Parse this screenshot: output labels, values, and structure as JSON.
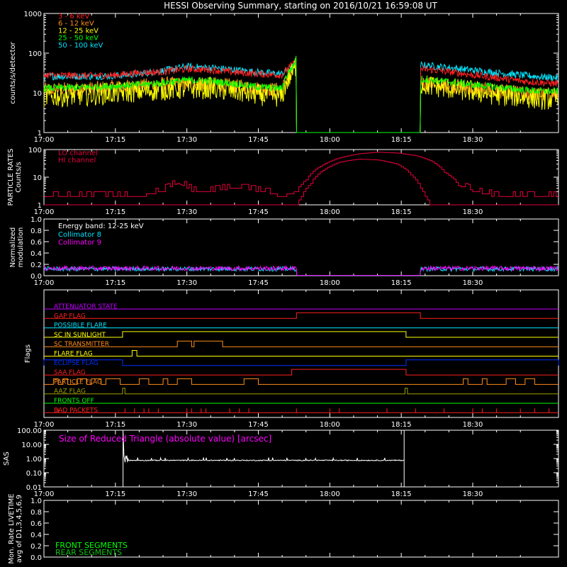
{
  "title": "HESSI Observing Summary, starting on 2016/10/21 16:59:08 UT",
  "time_ticks": [
    "17:00",
    "17:15",
    "17:30",
    "17:45",
    "18:00",
    "18:15",
    "18:30"
  ],
  "time_range_minutes": [
    0,
    108
  ],
  "colors": {
    "axes": "#ffffff",
    "red": "#ff2020",
    "orange": "#ff8c1a",
    "yellow": "#ffff00",
    "green": "#00ff00",
    "cyan": "#00e5ff",
    "magenta": "#ff00ff",
    "blue": "#0030ff",
    "purple": "#c000ff",
    "crimson": "#e0003a",
    "olive": "#a0a000",
    "darkgreen": "#10c010"
  },
  "chart_data": [
    {
      "type": "line",
      "panel": "count-rates",
      "ylabel": "counts/s/detector",
      "yscale": "log",
      "ylim": [
        1,
        1000
      ],
      "yticks": [
        "1",
        "10",
        "100",
        "1000"
      ],
      "gap_minutes": [
        53,
        79
      ],
      "series": [
        {
          "name": "3 - 6 keV",
          "color": "#ff2020",
          "knots": [
            [
              0,
              28
            ],
            [
              10,
              27
            ],
            [
              15,
              28
            ],
            [
              20,
              32
            ],
            [
              25,
              34
            ],
            [
              30,
              40
            ],
            [
              35,
              38
            ],
            [
              40,
              33
            ],
            [
              45,
              30
            ],
            [
              50,
              28
            ],
            [
              52.5,
              55
            ],
            [
              53,
              70
            ],
            [
              79.5,
              40
            ],
            [
              85,
              34
            ],
            [
              90,
              28
            ],
            [
              95,
              24
            ],
            [
              100,
              20
            ],
            [
              105,
              18
            ],
            [
              108,
              17
            ]
          ]
        },
        {
          "name": "6 - 12 keV",
          "color": "#ff8c1a",
          "knots": [
            [
              0,
              12
            ],
            [
              10,
              13
            ],
            [
              15,
              14
            ],
            [
              20,
              15
            ],
            [
              25,
              17
            ],
            [
              30,
              17
            ],
            [
              35,
              17
            ],
            [
              40,
              15
            ],
            [
              45,
              13
            ],
            [
              50,
              12
            ],
            [
              52.5,
              40
            ],
            [
              53,
              60
            ],
            [
              79.5,
              18
            ],
            [
              85,
              15
            ],
            [
              90,
              13
            ],
            [
              95,
              11
            ],
            [
              100,
              10
            ],
            [
              105,
              9
            ],
            [
              108,
              9
            ]
          ]
        },
        {
          "name": "12 - 25 keV",
          "color": "#ffff00",
          "knots": [
            [
              0,
              8
            ],
            [
              10,
              9
            ],
            [
              15,
              10
            ],
            [
              20,
              11
            ],
            [
              25,
              12
            ],
            [
              30,
              13
            ],
            [
              35,
              13
            ],
            [
              40,
              11
            ],
            [
              45,
              9
            ],
            [
              50,
              8
            ],
            [
              52.5,
              35
            ],
            [
              53,
              55
            ],
            [
              79.5,
              16
            ],
            [
              85,
              13
            ],
            [
              90,
              11
            ],
            [
              95,
              9
            ],
            [
              100,
              8
            ],
            [
              105,
              7
            ],
            [
              108,
              7
            ]
          ]
        },
        {
          "name": "25 - 50 keV",
          "color": "#00ff00",
          "knots": [
            [
              0,
              13
            ],
            [
              10,
              14
            ],
            [
              15,
              15
            ],
            [
              20,
              16
            ],
            [
              25,
              18
            ],
            [
              30,
              21
            ],
            [
              35,
              20
            ],
            [
              40,
              17
            ],
            [
              45,
              14
            ],
            [
              50,
              13
            ],
            [
              52.5,
              50
            ],
            [
              53,
              80
            ],
            [
              79.5,
              22
            ],
            [
              85,
              19
            ],
            [
              90,
              16
            ],
            [
              95,
              14
            ],
            [
              100,
              12
            ],
            [
              105,
              11
            ],
            [
              108,
              11
            ]
          ]
        },
        {
          "name": "50 - 100 keV",
          "color": "#00e5ff",
          "knots": [
            [
              0,
              26
            ],
            [
              10,
              26
            ],
            [
              15,
              27
            ],
            [
              20,
              30
            ],
            [
              25,
              36
            ],
            [
              30,
              46
            ],
            [
              35,
              43
            ],
            [
              40,
              38
            ],
            [
              45,
              33
            ],
            [
              50,
              30
            ],
            [
              52.5,
              50
            ],
            [
              53,
              65
            ],
            [
              79.5,
              50
            ],
            [
              85,
              43
            ],
            [
              90,
              37
            ],
            [
              95,
              32
            ],
            [
              100,
              28
            ],
            [
              105,
              25
            ],
            [
              108,
              24
            ]
          ]
        }
      ]
    },
    {
      "type": "line",
      "panel": "particle-rates",
      "ylabel": "PARTICLE RATES",
      "ylabel2": "Counts/s",
      "yscale": "log",
      "ylim": [
        1,
        100
      ],
      "yticks": [
        "1",
        "10",
        "100"
      ],
      "series": [
        {
          "name": "LO channel",
          "color": "#e0003a",
          "knots": [
            [
              0,
              2
            ],
            [
              15,
              2
            ],
            [
              20,
              2
            ],
            [
              25,
              3
            ],
            [
              28,
              6
            ],
            [
              31,
              3
            ],
            [
              35,
              3
            ],
            [
              40,
              4
            ],
            [
              45,
              3
            ],
            [
              50,
              2
            ],
            [
              53,
              3
            ],
            [
              55,
              8
            ],
            [
              58,
              25
            ],
            [
              62,
              50
            ],
            [
              66,
              70
            ],
            [
              70,
              80
            ],
            [
              74,
              75
            ],
            [
              78,
              60
            ],
            [
              81,
              40
            ],
            [
              84,
              15
            ],
            [
              87,
              5
            ],
            [
              90,
              3
            ],
            [
              95,
              2
            ],
            [
              100,
              2
            ],
            [
              108,
              2
            ]
          ]
        },
        {
          "name": "HI channel",
          "color": "#e0003a",
          "knots": [
            [
              0,
              1
            ],
            [
              53,
              1
            ],
            [
              54,
              2
            ],
            [
              56,
              6
            ],
            [
              59,
              20
            ],
            [
              62,
              35
            ],
            [
              66,
              45
            ],
            [
              70,
              42
            ],
            [
              74,
              30
            ],
            [
              77,
              12
            ],
            [
              79,
              4
            ],
            [
              80,
              2
            ],
            [
              81,
              1
            ],
            [
              108,
              1
            ]
          ]
        }
      ]
    },
    {
      "type": "line",
      "panel": "modulation",
      "ylabel": "Normalized",
      "ylabel2": "modulation",
      "ylim": [
        0,
        1
      ],
      "yticks": [
        "0.0",
        "0.2",
        "0.4",
        "0.6",
        "0.8",
        "1.0"
      ],
      "energy_band": "Energy band: 12-25 keV",
      "gap_minutes": [
        53,
        79
      ],
      "series": [
        {
          "name": "Collimator 8",
          "color": "#00e5ff",
          "level": 0.12
        },
        {
          "name": "Collimator 9",
          "color": "#ff00ff",
          "level": 0.13
        }
      ]
    },
    {
      "type": "line",
      "panel": "flags",
      "ylabel": "Flags",
      "flags": [
        {
          "name": "ATTENUATOR STATE",
          "color": "#c000ff",
          "segments": []
        },
        {
          "name": "GAP FLAG",
          "color": "#ff2020",
          "segments": [
            [
              53,
              79
            ]
          ]
        },
        {
          "name": "POSSIBLE FLARE",
          "color": "#00e5ff",
          "segments": []
        },
        {
          "name": "SC IN SUNLIGHT",
          "color": "#ffff00",
          "segments": [
            [
              16.5,
              76
            ]
          ]
        },
        {
          "name": "SC TRANSMITTER",
          "color": "#ff8c1a",
          "segments": [
            [
              28,
              31
            ],
            [
              31.5,
              37.5
            ]
          ]
        },
        {
          "name": "FLARE FLAG",
          "color": "#ffff00",
          "segments": [
            [
              18.5,
              19.5
            ]
          ]
        },
        {
          "name": "ECLIPSE FLAG",
          "color": "#0030ff",
          "segments": [
            [
              0,
              16.5
            ],
            [
              76,
              108
            ]
          ]
        },
        {
          "name": "SAA FLAG",
          "color": "#ff2020",
          "segments": [
            [
              52,
              76
            ]
          ]
        },
        {
          "name": "PARTICLE FLAG",
          "color": "#ff8c1a",
          "segments": [
            [
              2,
              3
            ],
            [
              4,
              5
            ],
            [
              7,
              9
            ],
            [
              10,
              12
            ],
            [
              13,
              16
            ],
            [
              20,
              22
            ],
            [
              25,
              26
            ],
            [
              28,
              31
            ],
            [
              42,
              45
            ],
            [
              88,
              89
            ],
            [
              92,
              93
            ],
            [
              97,
              99
            ],
            [
              101,
              103
            ]
          ]
        },
        {
          "name": "AAZ FLAG",
          "color": "#a0a000",
          "segments": [
            [
              16.5,
              17
            ],
            [
              75.8,
              76.3
            ]
          ]
        },
        {
          "name": "FRONTS OFF",
          "color": "#00ff00",
          "segments": []
        },
        {
          "name": "BAD PACKETS",
          "color": "#ff2020",
          "spikes": [
            3,
            17,
            19,
            21,
            22,
            24,
            30,
            31,
            33,
            34,
            39,
            41,
            43,
            53,
            60,
            62,
            72,
            78,
            84,
            90,
            92,
            95,
            100,
            103,
            106
          ]
        }
      ]
    },
    {
      "type": "line",
      "panel": "sas",
      "ylabel": "SAS",
      "yscale": "log",
      "ylim": [
        0.01,
        100
      ],
      "yticks": [
        "0.01",
        "0.10",
        "1.00",
        "10.00",
        "100.00"
      ],
      "annotation": "Size of Reduced Triangle (absolute value) [arcsec]",
      "series": [
        {
          "name": "Size of Reduced Triangle",
          "color": "#ffffff",
          "x_range": [
            16.6,
            75.6
          ],
          "level": 0.75,
          "spike_peak": 100
        }
      ]
    },
    {
      "type": "line",
      "panel": "livetime",
      "ylabel": "Mon. Rate LIVETIME",
      "ylabel2": "avg of D1,3,4,5,6,9",
      "ylim": [
        0,
        1
      ],
      "yticks": [
        "0.0",
        "0.2",
        "0.4",
        "0.6",
        "0.8",
        "1.0"
      ],
      "series": [
        {
          "name": "FRONT SEGMENTS",
          "color": "#00ff00"
        },
        {
          "name": "REAR SEGMENTS",
          "color": "#10c010"
        }
      ]
    }
  ]
}
